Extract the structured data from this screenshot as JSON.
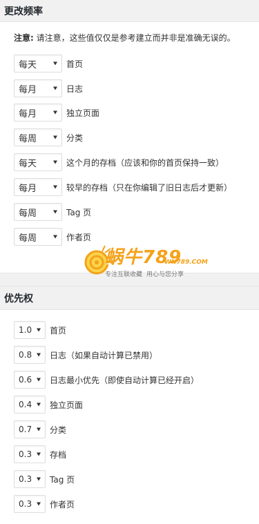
{
  "frequency": {
    "title": "更改频率",
    "note_label": "注意:",
    "note_text": " 请注意，这些值仅仅是参考建立而并非是准确无误的。",
    "rows": [
      {
        "value": "每天",
        "label": "首页"
      },
      {
        "value": "每月",
        "label": "日志"
      },
      {
        "value": "每月",
        "label": "独立页面"
      },
      {
        "value": "每周",
        "label": "分类"
      },
      {
        "value": "每天",
        "label": "这个月的存档（应该和你的首页保持一致）"
      },
      {
        "value": "每月",
        "label": "较早的存档（只在你编辑了旧日志后才更新）"
      },
      {
        "value": "每周",
        "label": "Tag 页"
      },
      {
        "value": "每周",
        "label": "作者页"
      }
    ]
  },
  "priority": {
    "title": "优先权",
    "rows": [
      {
        "value": "1.0",
        "label": "首页"
      },
      {
        "value": "0.8",
        "label": "日志（如果自动计算已禁用）"
      },
      {
        "value": "0.6",
        "label": "日志最小优先（即使自动计算已经开启）"
      },
      {
        "value": "0.4",
        "label": "独立页面"
      },
      {
        "value": "0.7",
        "label": "分类"
      },
      {
        "value": "0.3",
        "label": "存档"
      },
      {
        "value": "0.3",
        "label": "Tag 页"
      },
      {
        "value": "0.3",
        "label": "作者页"
      }
    ]
  },
  "watermark": {
    "brand": "蜗牛789",
    "domain": "WN789.COM",
    "slogan_1": "专注互联收藏",
    "slogan_2": "用心与您分享",
    "color": "#f4a21a"
  }
}
